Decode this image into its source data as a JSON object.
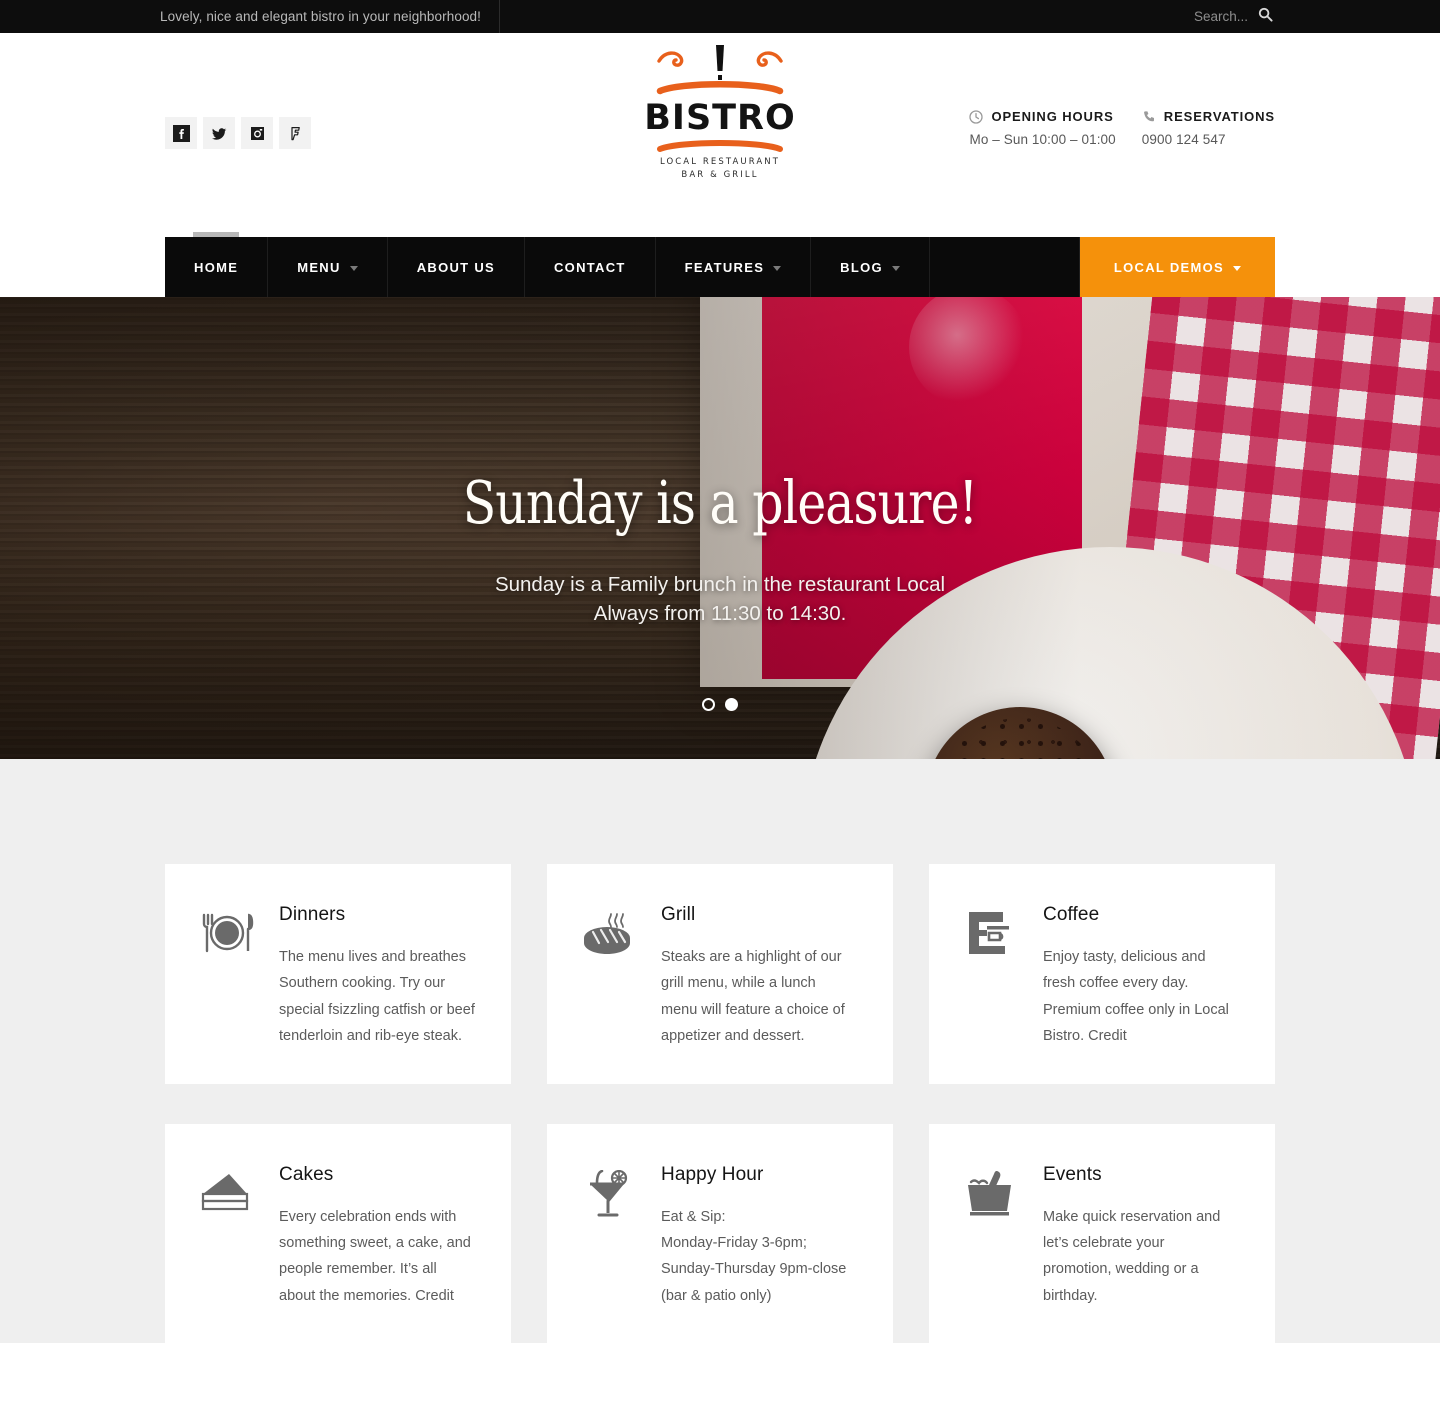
{
  "topbar": {
    "tagline": "Lovely, nice and elegant bistro in your neighborhood!",
    "search_placeholder": "Search...",
    "search_value": ""
  },
  "header": {
    "social": [
      {
        "name": "facebook",
        "label": "Facebook"
      },
      {
        "name": "twitter",
        "label": "Twitter"
      },
      {
        "name": "instagram",
        "label": "Instagram"
      },
      {
        "name": "foursquare",
        "label": "Foursquare"
      }
    ],
    "logo": {
      "word": "BISTRO",
      "sub_line1": "LOCAL RESTAURANT",
      "sub_line2": "BAR & GRILL",
      "accent_color": "#e8601c"
    },
    "opening": {
      "title": "OPENING HOURS",
      "value": "Mo – Sun 10:00 – 01:00"
    },
    "reservations": {
      "title": "RESERVATIONS",
      "value": "0900 124 547"
    }
  },
  "nav": {
    "accent_color": "#f5910b",
    "items": [
      {
        "label": "HOME",
        "caret": false,
        "active": true
      },
      {
        "label": "MENU",
        "caret": true,
        "active": false
      },
      {
        "label": "ABOUT US",
        "caret": false,
        "active": false
      },
      {
        "label": "CONTACT",
        "caret": false,
        "active": false
      },
      {
        "label": "FEATURES",
        "caret": true,
        "active": false
      },
      {
        "label": "BLOG",
        "caret": true,
        "active": false
      }
    ],
    "demos": {
      "label": "LOCAL DEMOS",
      "caret": true
    }
  },
  "hero": {
    "title": "Sunday is a pleasure!",
    "subtitle_line1": "Sunday is a Family brunch in the restaurant Local",
    "subtitle_line2": "Always from 11:30 to 14:30.",
    "slides_total": 2,
    "active_slide": 2
  },
  "features": [
    {
      "icon": "plate-cutlery-icon",
      "title": "Dinners",
      "lines": [
        "The menu lives and breathes",
        "Southern cooking. Try our",
        "special fsizzling catfish or beef",
        "tenderloin and rib-eye steak."
      ]
    },
    {
      "icon": "steak-grill-icon",
      "title": "Grill",
      "lines": [
        "Steaks are a highlight of our",
        "grill menu, while a lunch",
        "menu will feature a choice of",
        "appetizer and dessert."
      ]
    },
    {
      "icon": "coffee-machine-icon",
      "title": "Coffee",
      "lines": [
        "Enjoy tasty, delicious and",
        "fresh coffee every day.",
        "Premium coffee only in Local",
        "Bistro. Credit"
      ]
    },
    {
      "icon": "cake-slice-icon",
      "title": "Cakes",
      "lines": [
        "Every celebration ends with",
        "something sweet, a cake, and",
        "people remember. It’s all",
        "about the memories. Credit"
      ]
    },
    {
      "icon": "cocktail-glass-icon",
      "title": "Happy Hour",
      "lines": [
        "Eat & Sip:",
        "Monday-Friday 3-6pm;",
        "Sunday-Thursday 9pm-close",
        "(bar & patio only)"
      ]
    },
    {
      "icon": "champagne-bucket-icon",
      "title": "Events",
      "lines": [
        "Make quick reservation and",
        "let’s celebrate your",
        "promotion, wedding or a",
        "birthday."
      ]
    }
  ]
}
